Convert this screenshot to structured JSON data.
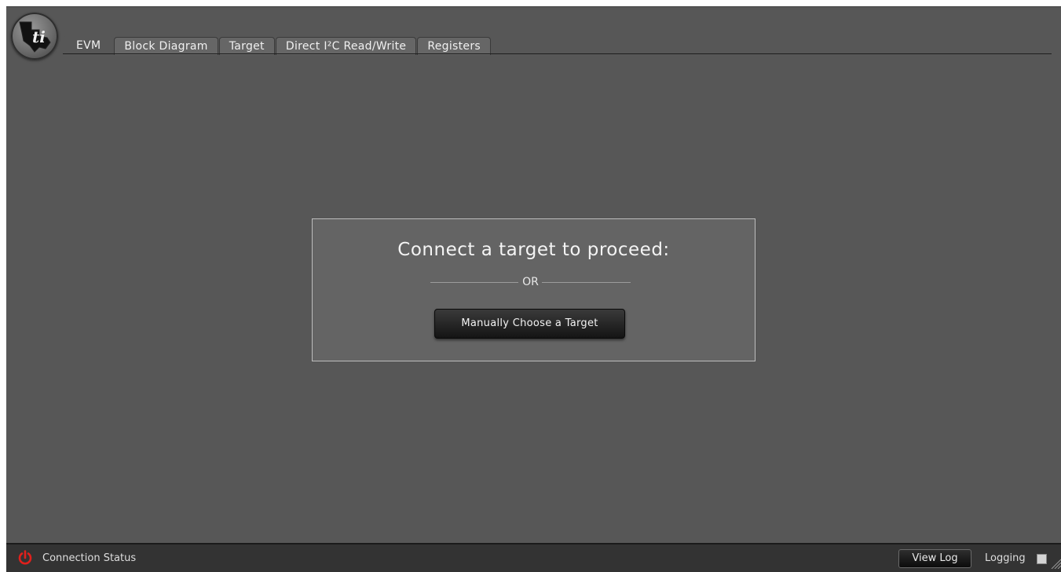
{
  "header": {
    "logo_icon": "texas-instruments-logo",
    "tabs": [
      {
        "label": "EVM",
        "active": true
      },
      {
        "label": "Block Diagram",
        "active": false
      },
      {
        "label": "Target",
        "active": false
      },
      {
        "label": "Direct I²C Read/Write",
        "active": false
      },
      {
        "label": "Registers",
        "active": false
      }
    ]
  },
  "main": {
    "title": "Connect a target to proceed:",
    "divider_text": "OR",
    "manual_button_label": "Manually Choose a Target"
  },
  "statusbar": {
    "power_icon": "power-icon",
    "power_color": "#e0201c",
    "connection_label": "Connection Status",
    "view_log_label": "View Log",
    "logging_label": "Logging",
    "logging_checked": false
  }
}
